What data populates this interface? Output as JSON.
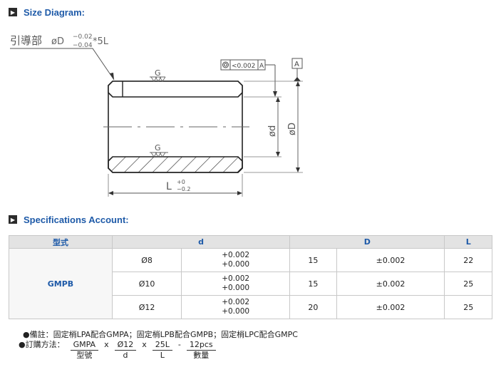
{
  "size_diagram": {
    "heading": "Size Diagram:",
    "guide_label": "引導部",
    "guide_dim": "øD",
    "guide_tol_upper": "−0.02",
    "guide_tol_lower": "−0.04",
    "guide_suffix": "*5L",
    "tolerance_frame": "<0.002",
    "datum": "A",
    "finish_mark_top": "G",
    "finish_mark_bottom": "G",
    "dim_inner": "ød",
    "dim_outer": "øD",
    "length_label": "L",
    "length_tol_upper": "+0",
    "length_tol_lower": "−0.2"
  },
  "spec_section": {
    "heading": "Specifications Account:"
  },
  "table": {
    "headers": [
      "型式",
      "d",
      "D",
      "L"
    ],
    "model": "GMPB",
    "rows": [
      {
        "d": "Ø8",
        "d_tol_upper": "+0.002",
        "d_tol_lower": "+0.000",
        "D": "15",
        "D_tol": "±0.002",
        "L": "22"
      },
      {
        "d": "Ø10",
        "d_tol_upper": "+0.002",
        "d_tol_lower": "+0.000",
        "D": "15",
        "D_tol": "±0.002",
        "L": "25"
      },
      {
        "d": "Ø12",
        "d_tol_upper": "+0.002",
        "d_tol_lower": "+0.000",
        "D": "20",
        "D_tol": "±0.002",
        "L": "25"
      }
    ]
  },
  "note": "●備註：固定梢LPA配合GMPA；固定梢LPB配合GMPB；固定梢LPC配合GMPC",
  "order": {
    "label": "●訂購方法：",
    "items": [
      {
        "value": "GMPA",
        "caption": "型號"
      },
      {
        "value": "Ø12",
        "caption": "d"
      },
      {
        "value": "25L",
        "caption": "L"
      },
      {
        "value": "12pcs",
        "caption": "數量"
      }
    ],
    "separators": [
      "x",
      "x",
      "-"
    ]
  }
}
